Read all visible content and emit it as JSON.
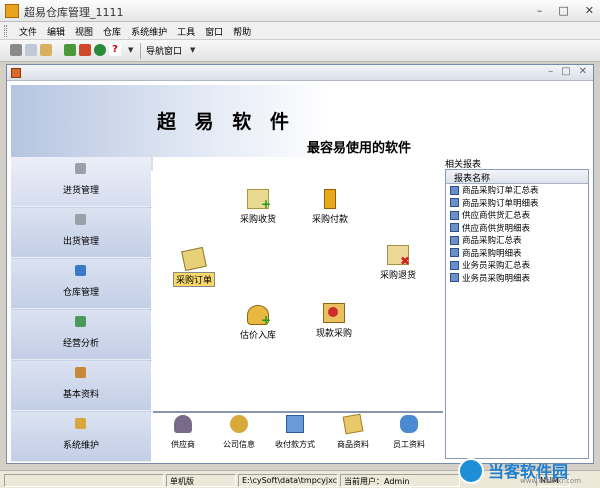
{
  "window": {
    "title": "超易仓库管理_1111",
    "controls": [
      "–",
      "□",
      "✕"
    ]
  },
  "menu": [
    "文件",
    "编辑",
    "视图",
    "仓库",
    "系统维护",
    "工具",
    "窗口",
    "帮助"
  ],
  "toolbar": {
    "nav_label": "导航窗口"
  },
  "child_window": {
    "controls": [
      "–",
      "□",
      "✕"
    ]
  },
  "banner": {
    "title": "超 易 软 件",
    "slogan": "最容易使用的软件"
  },
  "nav": [
    {
      "label": "进货管理",
      "active": true
    },
    {
      "label": "出货管理"
    },
    {
      "label": "仓库管理"
    },
    {
      "label": "经营分析"
    },
    {
      "label": "基本资料"
    },
    {
      "label": "系统维护"
    }
  ],
  "flow": {
    "purchase_receive": "采购收货",
    "purchase_pay": "采购付款",
    "purchase_order": "采购订单",
    "purchase_return": "采购退货",
    "estimate_stock_in": "估价入库",
    "cash_purchase": "现款采购"
  },
  "bottom": [
    "供应商",
    "公司信息",
    "收付款方式",
    "商品资料",
    "员工资料"
  ],
  "related": {
    "title": "相关报表",
    "header": "报表名称",
    "rows": [
      "商品采购订单汇总表",
      "商品采购订单明细表",
      "供应商供货汇总表",
      "供应商供货明细表",
      "商品采购汇总表",
      "商品采购明细表",
      "业务员采购汇总表",
      "业务员采购明细表"
    ]
  },
  "status": {
    "edition": "单机版",
    "path": "E:\\cySoft\\data\\tmpcyjxc.sys",
    "user": "当前用户：Admin",
    "num": "NUM"
  },
  "watermark": {
    "text": "当客软件园",
    "url": "www.downkr.com"
  }
}
